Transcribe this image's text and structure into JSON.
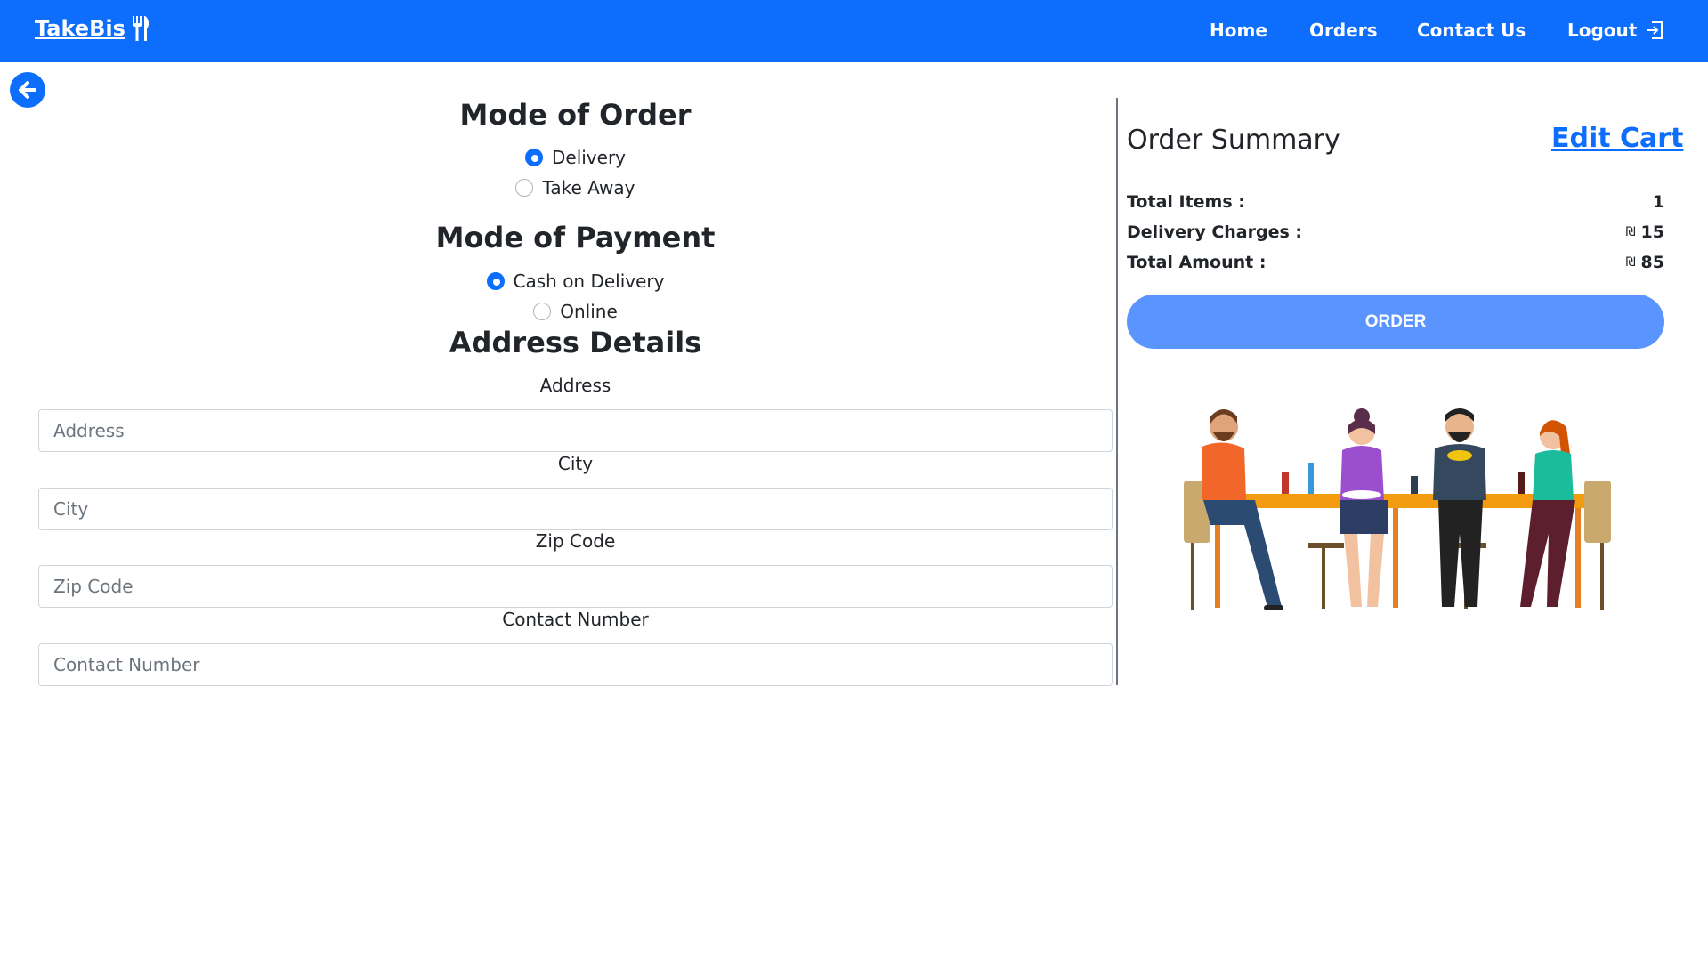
{
  "navbar": {
    "brand": "TakeBis",
    "links": [
      "Home",
      "Orders",
      "Contact Us",
      "Logout"
    ],
    "accent": "#0d6efd"
  },
  "icons": {
    "brand_icon": "fork-knife-icon",
    "back": "arrow-left-icon",
    "logout": "logout-icon"
  },
  "order_mode": {
    "title": "Mode of Order",
    "options": [
      {
        "label": "Delivery",
        "selected": true
      },
      {
        "label": "Take Away",
        "selected": false
      }
    ]
  },
  "payment_mode": {
    "title": "Mode of Payment",
    "options": [
      {
        "label": "Cash on Delivery",
        "selected": true
      },
      {
        "label": "Online",
        "selected": false
      }
    ]
  },
  "address": {
    "title": "Address Details",
    "fields": [
      {
        "label": "Address",
        "placeholder": "Address",
        "value": ""
      },
      {
        "label": "City",
        "placeholder": "City",
        "value": ""
      },
      {
        "label": "Zip Code",
        "placeholder": "Zip Code",
        "value": ""
      },
      {
        "label": "Contact Number",
        "placeholder": "Contact Number",
        "value": ""
      }
    ]
  },
  "summary": {
    "title": "Order Summary",
    "edit_cart": "Edit Cart",
    "total_items_label": "Total Items :",
    "total_items_value": "1",
    "delivery_label": "Delivery Charges :",
    "delivery_currency": "₪",
    "delivery_value": "15",
    "total_label": "Total Amount :",
    "total_currency": "₪",
    "total_value": "85",
    "order_button": "ORDER",
    "button_color": "#5a95ff"
  }
}
